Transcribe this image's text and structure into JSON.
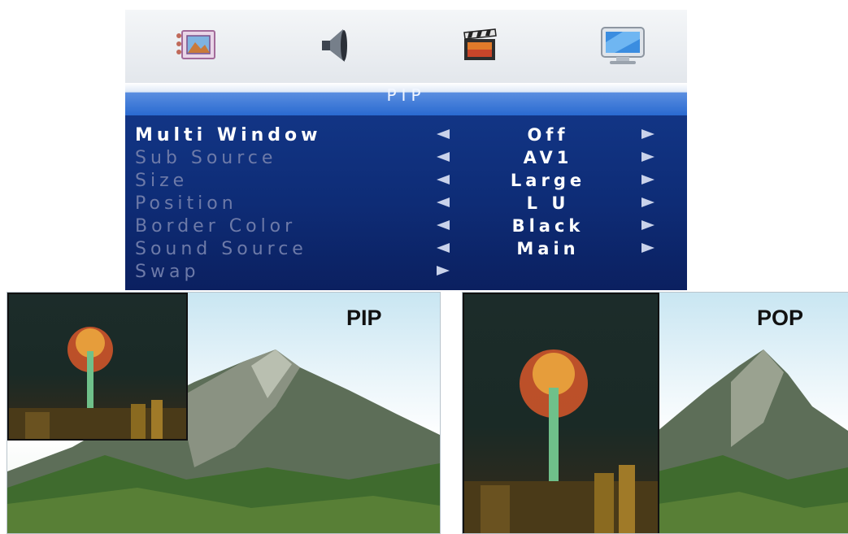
{
  "osd": {
    "title": "PIP",
    "icons": [
      "picture-icon",
      "sound-icon",
      "movie-clapper-icon",
      "monitor-icon"
    ],
    "rows": [
      {
        "label": "Multi Window",
        "value": "Off",
        "active": true
      },
      {
        "label": "Sub Source",
        "value": "AV1",
        "active": false
      },
      {
        "label": "Size",
        "value": "Large",
        "active": false
      },
      {
        "label": "Position",
        "value": "L U",
        "active": false
      },
      {
        "label": "Border Color",
        "value": "Black",
        "active": false
      },
      {
        "label": "Sound Source",
        "value": "Main",
        "active": false
      },
      {
        "label": "Swap",
        "value": "",
        "active": false
      }
    ]
  },
  "examples": {
    "pip_label": "PIP",
    "pop_label": "POP"
  },
  "colors": {
    "menu_bg": "#0f2a6e",
    "title_bar": "#2a6ad0",
    "active_text": "#ffffff",
    "inactive_text": "#6d7aa8"
  }
}
